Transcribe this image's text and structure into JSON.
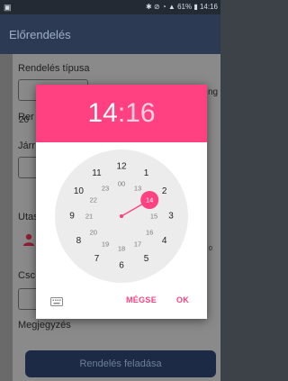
{
  "status_bar": {
    "battery_percent": "61%",
    "time": "14:16"
  },
  "app_bar": {
    "title": "Előrendelés"
  },
  "form": {
    "order_type_label": "Rendelés típusa",
    "order_type_side_text": "ng",
    "date_label": "Rer",
    "date_value": "20",
    "vehicle_label": "Járr",
    "passengers_label": "Utas",
    "passenger_count_partial": "0",
    "package_label": "Csc",
    "comment_label": "Megjegyzés",
    "submit_label": "Rendelés feladása"
  },
  "time_picker": {
    "hour": "14",
    "separator": ":",
    "minute": "16",
    "selected_mode": "hours",
    "selected_value": "14",
    "outer_hours": [
      "12",
      "1",
      "2",
      "3",
      "4",
      "5",
      "6",
      "7",
      "8",
      "9",
      "10",
      "11"
    ],
    "inner_hours": [
      "00",
      "13",
      "14",
      "15",
      "16",
      "17",
      "18",
      "19",
      "20",
      "21",
      "22",
      "23"
    ],
    "cancel_label": "MÉGSE",
    "ok_label": "OK"
  },
  "colors": {
    "accent": "#ff4081",
    "app_bar": "#2c3b53",
    "submit_button": "#1c2a45",
    "clock_face": "#ececec"
  }
}
